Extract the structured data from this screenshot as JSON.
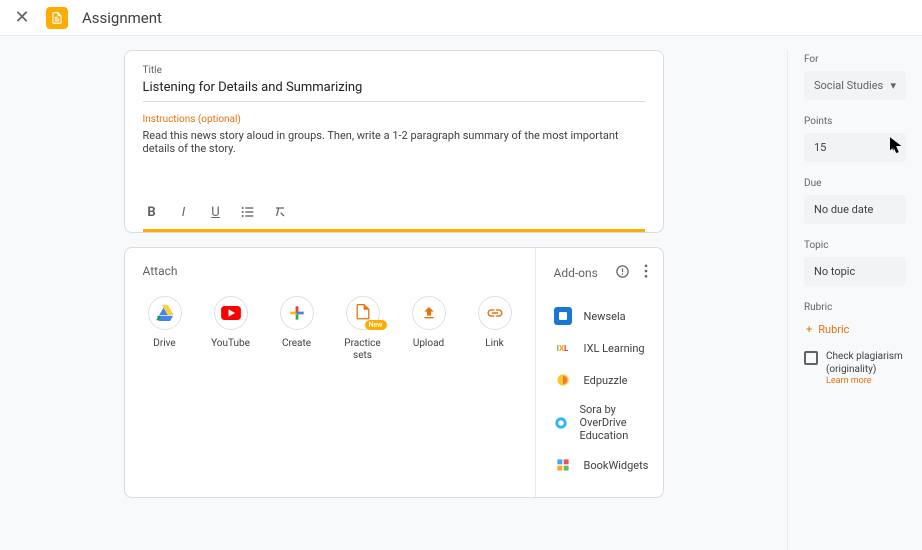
{
  "header": {
    "title": "Assignment"
  },
  "assignment": {
    "title_label": "Title",
    "title_value": "Listening for Details and Summarizing",
    "instructions_label": "Instructions (optional)",
    "instructions_value": "Read this news story aloud in groups. Then, write a 1-2 paragraph summary of the most important details of the story."
  },
  "attach": {
    "heading": "Attach",
    "items": [
      {
        "name": "Drive"
      },
      {
        "name": "YouTube"
      },
      {
        "name": "Create"
      },
      {
        "name": "Practice sets",
        "badge": "New"
      },
      {
        "name": "Upload"
      },
      {
        "name": "Link"
      }
    ]
  },
  "addons": {
    "heading": "Add-ons",
    "items": [
      {
        "name": "Newsela"
      },
      {
        "name": "IXL Learning"
      },
      {
        "name": "Edpuzzle"
      },
      {
        "name": "Sora by OverDrive Education"
      },
      {
        "name": "BookWidgets"
      }
    ]
  },
  "sidebar": {
    "for_label": "For",
    "for_value": "Social Studies",
    "points_label": "Points",
    "points_value": "15",
    "due_label": "Due",
    "due_value": "No due date",
    "topic_label": "Topic",
    "topic_value": "No topic",
    "rubric_label": "Rubric",
    "rubric_button": "Rubric",
    "plagiarism_label": "Check plagiarism (originality)",
    "learn_more": "Learn more"
  }
}
